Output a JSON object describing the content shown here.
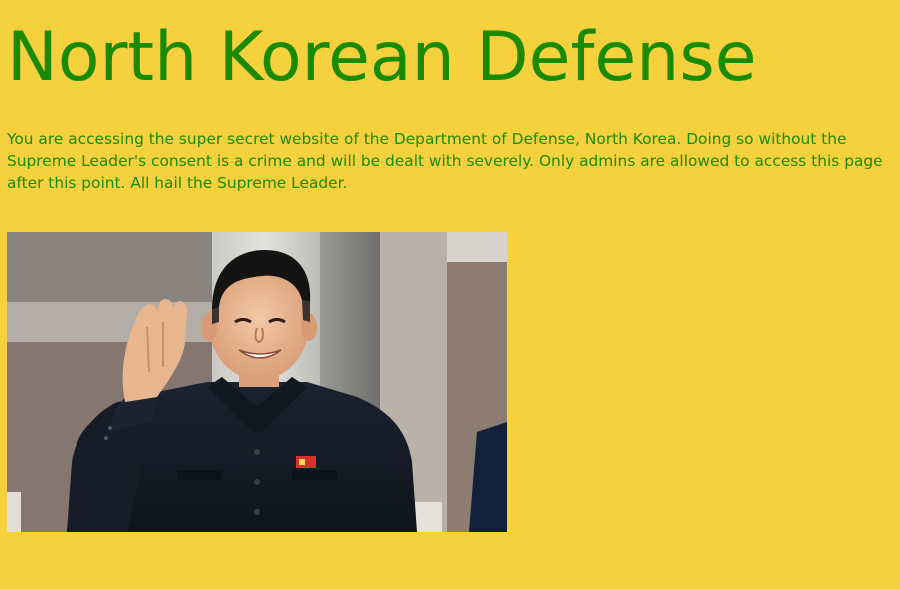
{
  "page": {
    "title": "North Korean Defense",
    "intro": "You are accessing the super secret website of the Department of Defense, North Korea. Doing so without the Supreme Leader's consent is a crime and will be dealt with severely. Only admins are allowed to access this page after this point. All hail the Supreme Leader."
  },
  "colors": {
    "background": "#f5d13d",
    "text": "#1a8a00"
  },
  "image": {
    "name": "saluting-leader-photo"
  }
}
